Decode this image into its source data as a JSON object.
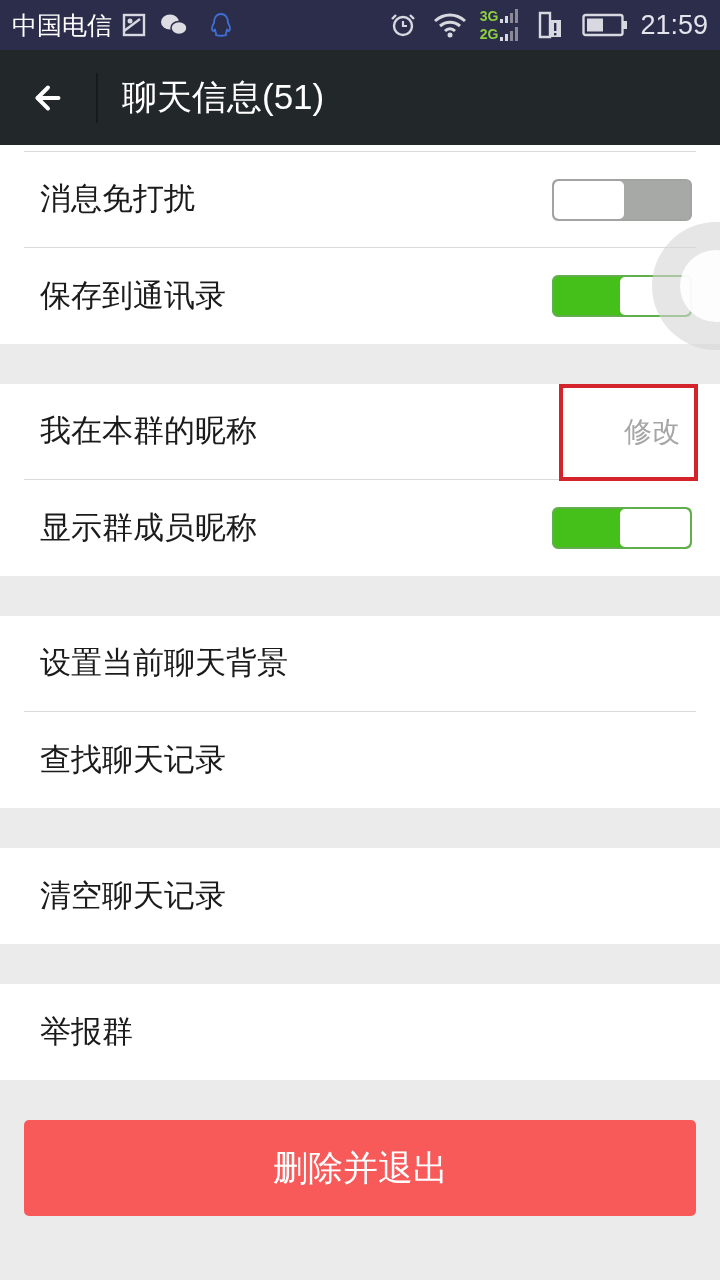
{
  "status_bar": {
    "carrier": "中国电信",
    "network_top": "3G",
    "network_bottom": "2G",
    "time": "21:59"
  },
  "header": {
    "title": "聊天信息(51)"
  },
  "sections": [
    {
      "rows": [
        {
          "kind": "toggle",
          "label": "消息免打扰",
          "on": false
        },
        {
          "kind": "toggle",
          "label": "保存到通讯录",
          "on": true
        }
      ]
    },
    {
      "rows": [
        {
          "kind": "action",
          "label": "我在本群的昵称",
          "value": "修改",
          "highlighted": true
        },
        {
          "kind": "toggle",
          "label": "显示群成员昵称",
          "on": true
        }
      ]
    },
    {
      "rows": [
        {
          "kind": "plain",
          "label": "设置当前聊天背景"
        },
        {
          "kind": "plain",
          "label": "查找聊天记录"
        }
      ]
    },
    {
      "rows": [
        {
          "kind": "plain",
          "label": "清空聊天记录"
        }
      ]
    },
    {
      "rows": [
        {
          "kind": "plain",
          "label": "举报群"
        }
      ]
    }
  ],
  "delete_button": {
    "label": "删除并退出"
  }
}
